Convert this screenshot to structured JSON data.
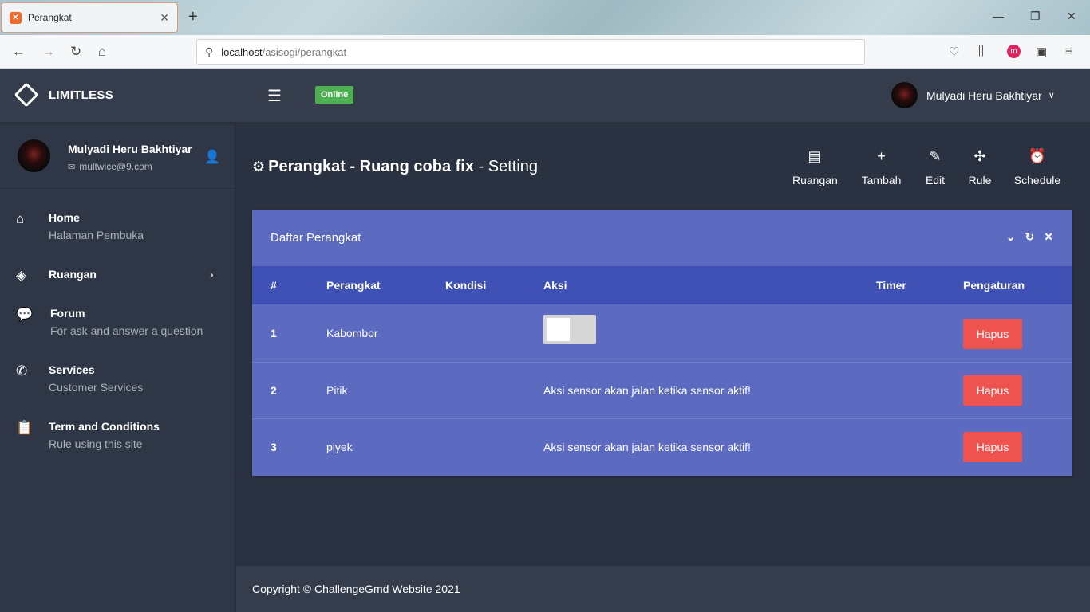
{
  "browser": {
    "tab_title": "Perangkat",
    "url_host": "localhost",
    "url_path": "/asisogi/perangkat"
  },
  "header": {
    "brand": "LIMITLESS",
    "status_badge": "Online",
    "user_name": "Mulyadi Heru Bakhtiyar"
  },
  "sidebar": {
    "user_name": "Mulyadi Heru Bakhtiyar",
    "user_email": "multwice@9.com",
    "items": [
      {
        "label": "Home",
        "sub": "Halaman Pembuka",
        "icon": "home-icon"
      },
      {
        "label": "Ruangan",
        "sub": "",
        "icon": "layers-icon"
      },
      {
        "label": "Forum",
        "sub": "For ask and answer a question",
        "icon": "chat-icon"
      },
      {
        "label": "Services",
        "sub": "Customer Services",
        "icon": "phone-icon"
      },
      {
        "label": "Term and Conditions",
        "sub": "Rule using this site",
        "icon": "clipboard-icon"
      }
    ]
  },
  "page": {
    "title_bold": "Perangkat - Ruang coba fix",
    "title_rest": "- Setting",
    "actions": [
      "Ruangan",
      "Tambah",
      "Edit",
      "Rule",
      "Schedule"
    ]
  },
  "card": {
    "title": "Daftar Perangkat",
    "columns": [
      "#",
      "Perangkat",
      "Kondisi",
      "Aksi",
      "Timer",
      "Pengaturan"
    ],
    "rows": [
      {
        "num": "1",
        "name": "Kabombor",
        "kondisi": "",
        "aksi": "",
        "timer": "",
        "button": "Hapus"
      },
      {
        "num": "2",
        "name": "Pitik",
        "kondisi": "",
        "aksi": "Aksi sensor akan jalan ketika sensor aktif!",
        "timer": "",
        "button": "Hapus"
      },
      {
        "num": "3",
        "name": "piyek",
        "kondisi": "",
        "aksi": "Aksi sensor akan jalan ketika sensor aktif!",
        "timer": "",
        "button": "Hapus"
      }
    ]
  },
  "footer": {
    "copyright": "Copyright © ChallengeGmd Website 2021"
  },
  "colors": {
    "card": "#5c6bc0",
    "table_header": "#3f51b5",
    "danger": "#ef5350",
    "online": "#4caf50"
  }
}
